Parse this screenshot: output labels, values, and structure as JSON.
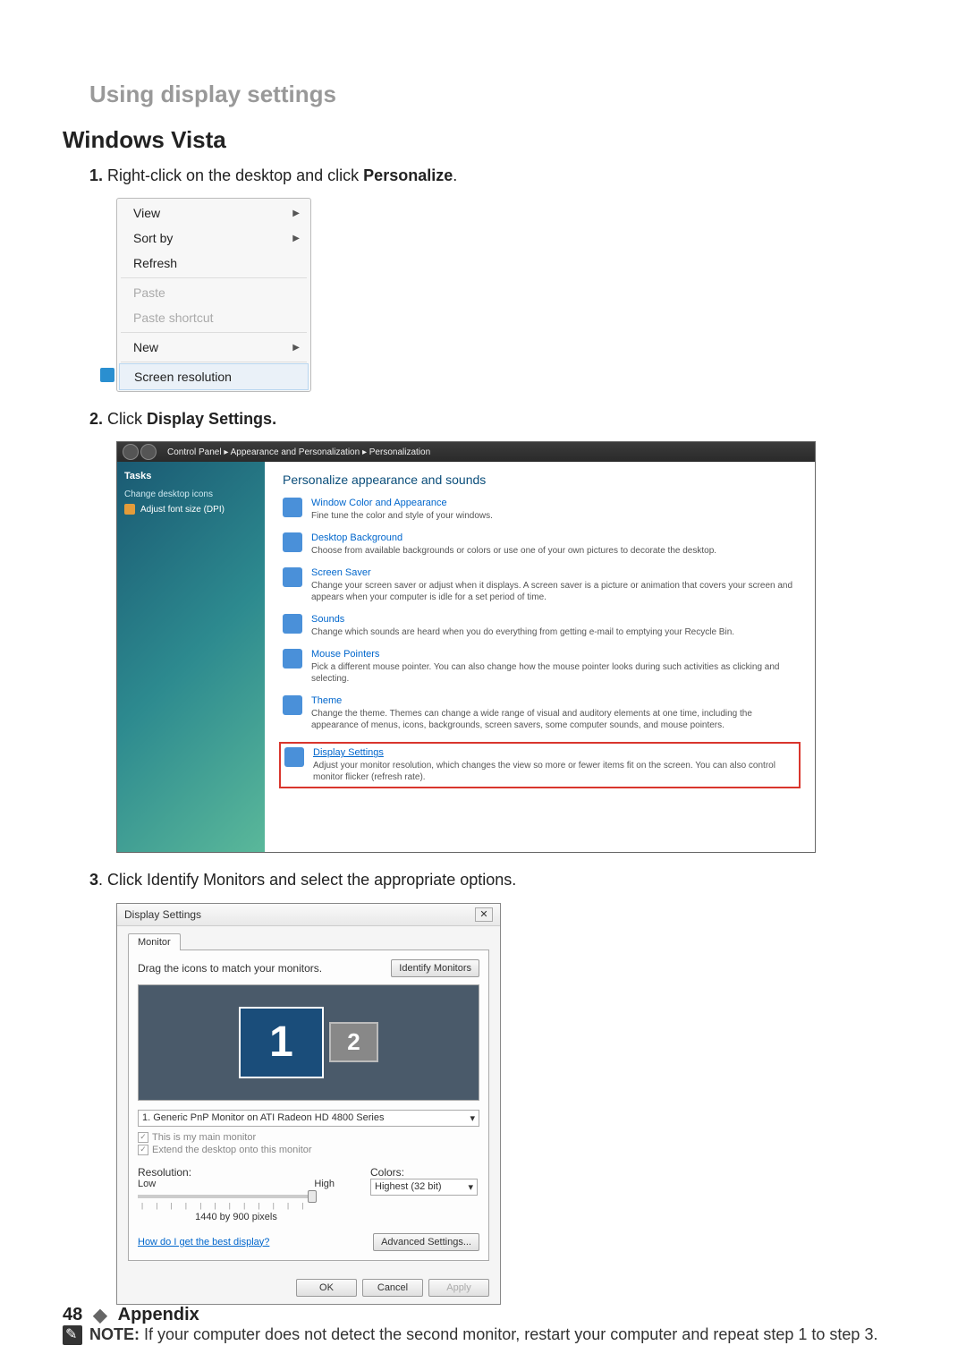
{
  "section_title": "Using display settings",
  "os_heading": "Windows Vista",
  "step1": {
    "num": "1.",
    "prefix": "Right-click on the desktop and click ",
    "bold": "Personalize",
    "suffix": "."
  },
  "context_menu": {
    "view": "View",
    "sort_by": "Sort by",
    "refresh": "Refresh",
    "paste": "Paste",
    "paste_shortcut": "Paste shortcut",
    "new": "New",
    "screen_resolution": "Screen resolution"
  },
  "step2": {
    "num": "2.",
    "prefix": "Click ",
    "bold": "Display Settings."
  },
  "pwin": {
    "breadcrumb_cp": "Control Panel",
    "breadcrumb_ap": "Appearance and Personalization",
    "breadcrumb_p": "Personalization",
    "sidebar_title": "Tasks",
    "sidebar_link1": "Change desktop icons",
    "sidebar_link2": "Adjust font size (DPI)",
    "heading": "Personalize appearance and sounds",
    "opts": {
      "wca_t": "Window Color and Appearance",
      "wca_d": "Fine tune the color and style of your windows.",
      "db_t": "Desktop Background",
      "db_d": "Choose from available backgrounds or colors or use one of your own pictures to decorate the desktop.",
      "ss_t": "Screen Saver",
      "ss_d": "Change your screen saver or adjust when it displays. A screen saver is a picture or animation that covers your screen and appears when your computer is idle for a set period of time.",
      "snd_t": "Sounds",
      "snd_d": "Change which sounds are heard when you do everything from getting e-mail to emptying your Recycle Bin.",
      "mp_t": "Mouse Pointers",
      "mp_d": "Pick a different mouse pointer. You can also change how the mouse pointer looks during such activities as clicking and selecting.",
      "th_t": "Theme",
      "th_d": "Change the theme. Themes can change a wide range of visual and auditory elements at one time, including the appearance of menus, icons, backgrounds, screen savers, some computer sounds, and mouse pointers.",
      "ds_t": "Display Settings",
      "ds_d": "Adjust your monitor resolution, which changes the view so more or fewer items fit on the screen. You can also control monitor flicker (refresh rate)."
    }
  },
  "step3": {
    "num": "3",
    "suffix_dot": ".",
    "text": " Click Identify Monitors and select the appropriate options."
  },
  "ds": {
    "title": "Display Settings",
    "tab": "Monitor",
    "drag_text": "Drag the icons to match your monitors.",
    "identify_btn": "Identify Monitors",
    "mon1": "1",
    "mon2": "2",
    "monitor_sel": "1. Generic PnP Monitor on ATI Radeon HD 4800 Series",
    "main_chk": "This is my main monitor",
    "extend_chk": "Extend the desktop onto this monitor",
    "res_label": "Resolution:",
    "low": "Low",
    "high": "High",
    "res_value": "1440 by 900 pixels",
    "colors_label": "Colors:",
    "colors_value": "Highest (32 bit)",
    "help_link": "How do I get the best display?",
    "adv_btn": "Advanced Settings...",
    "ok": "OK",
    "cancel": "Cancel",
    "apply": "Apply"
  },
  "note": {
    "label": "NOTE:",
    "text": " If your computer does not detect the second monitor, restart your computer and repeat step 1 to step 3."
  },
  "footer": {
    "page": "48",
    "section": "Appendix"
  }
}
